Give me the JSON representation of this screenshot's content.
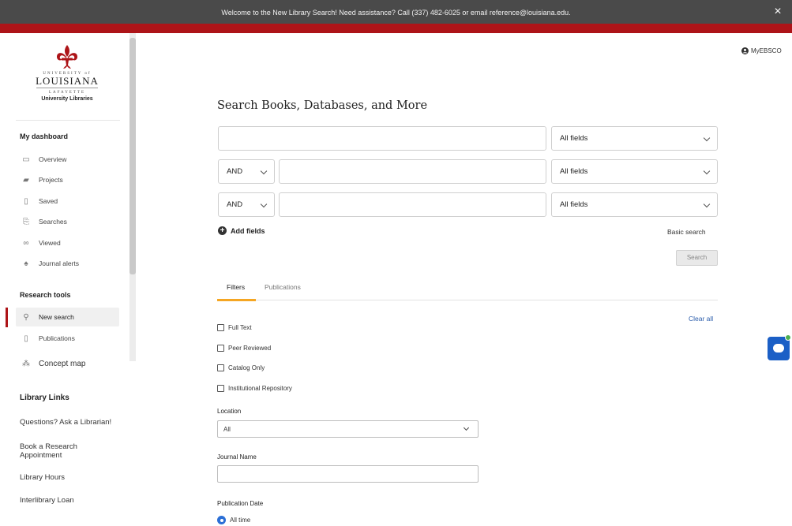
{
  "banner": {
    "text": "Welcome to the New Library Search! Need assistance? Call (337) 482-6025 or email reference@louisiana.edu.",
    "close_icon": "×"
  },
  "logo": {
    "small_text": "UNIVERSITY of",
    "name": "LOUISIANA",
    "small_text_2": "LAFAYETTE",
    "sub": "University Libraries"
  },
  "sidebar": {
    "dashboard_heading": "My dashboard",
    "dashboard_items": [
      {
        "label": "Overview",
        "icon": "overview-icon",
        "glyph": "▭"
      },
      {
        "label": "Projects",
        "icon": "projects-icon",
        "glyph": "▰"
      },
      {
        "label": "Saved",
        "icon": "saved-icon",
        "glyph": "▯"
      },
      {
        "label": "Searches",
        "icon": "searches-icon",
        "glyph": "⎘"
      },
      {
        "label": "Viewed",
        "icon": "viewed-icon",
        "glyph": "∞"
      },
      {
        "label": "Journal alerts",
        "icon": "bell-icon",
        "glyph": "♠"
      }
    ],
    "research_heading": "Research tools",
    "research_items": [
      {
        "label": "New search",
        "icon": "search-icon",
        "glyph": "⚲"
      },
      {
        "label": "Publications",
        "icon": "publications-icon",
        "glyph": "▯"
      },
      {
        "label": "Concept map",
        "icon": "concept-map-icon",
        "glyph": "⁂"
      }
    ],
    "library_heading": "Library Links",
    "library_links": [
      "Questions? Ask a Librarian!",
      "Book a Research Appointment",
      "Library Hours",
      "Interlibrary Loan"
    ]
  },
  "header": {
    "myebsco": "MyEBSCO"
  },
  "search": {
    "title": "Search Books, Databases, and More",
    "field_select": "All fields",
    "operator": "AND",
    "add_fields": "Add fields",
    "basic_search": "Basic search",
    "search_button": "Search"
  },
  "tabs": {
    "filters": "Filters",
    "publications": "Publications"
  },
  "filters": {
    "clear_all": "Clear all",
    "checkboxes": [
      "Full Text",
      "Peer Reviewed",
      "Catalog Only",
      "Institutional Repository"
    ],
    "location_label": "Location",
    "location_value": "All",
    "journal_label": "Journal Name",
    "journal_value": "",
    "date_label": "Publication Date",
    "date_option": "All time"
  },
  "colors": {
    "brand_red": "#ad1418",
    "tab_accent": "#f5a623",
    "link_blue": "#2a5cab",
    "chat_blue": "#1b5fc6"
  }
}
